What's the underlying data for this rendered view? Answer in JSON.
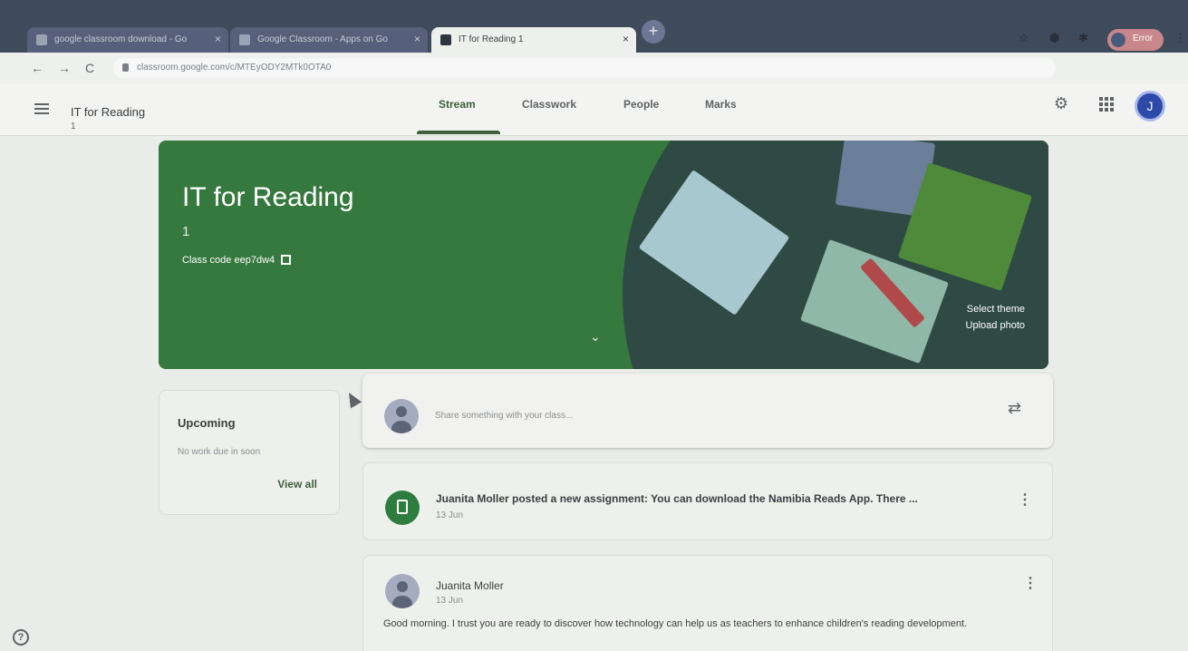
{
  "browser": {
    "tabs": [
      {
        "label": "google classroom download - Go",
        "active": false
      },
      {
        "label": "Google Classroom - Apps on Go",
        "active": false
      },
      {
        "label": "IT for Reading 1",
        "active": true
      }
    ],
    "tab_close_glyph": "×",
    "new_tab_glyph": "+",
    "url": "classroom.google.com/c/MTEyODY2MTk0OTA0",
    "profile_label": "Error"
  },
  "header": {
    "class_title": "IT for Reading",
    "class_section": "1",
    "tabs": [
      {
        "label": "Stream",
        "active": true
      },
      {
        "label": "Classwork",
        "active": false
      },
      {
        "label": "People",
        "active": false
      },
      {
        "label": "Marks",
        "active": false
      }
    ],
    "avatar_initial": "J"
  },
  "banner": {
    "title": "IT for Reading",
    "section": "1",
    "class_code_label": "Class code",
    "class_code": "eep7dw4",
    "select_theme": "Select theme",
    "upload_photo": "Upload photo",
    "theme_color": "#36793e"
  },
  "upcoming": {
    "title": "Upcoming",
    "empty_text": "No work due in soon",
    "view_all": "View all"
  },
  "share": {
    "placeholder": "Share something with your class..."
  },
  "posts": [
    {
      "text": "Juanita Moller posted a new assignment: You can download the Namibia Reads App. There ...",
      "date": "13 Jun"
    },
    {
      "author": "Juanita Moller",
      "date": "13 Jun",
      "body": "Good morning. I trust you are ready to discover how technology can help us as teachers to enhance children's reading development."
    }
  ],
  "icons": {
    "help": "?",
    "kebab": "⋮",
    "repost": "⇄",
    "chevron_down": "⌄",
    "gear": "⚙"
  }
}
